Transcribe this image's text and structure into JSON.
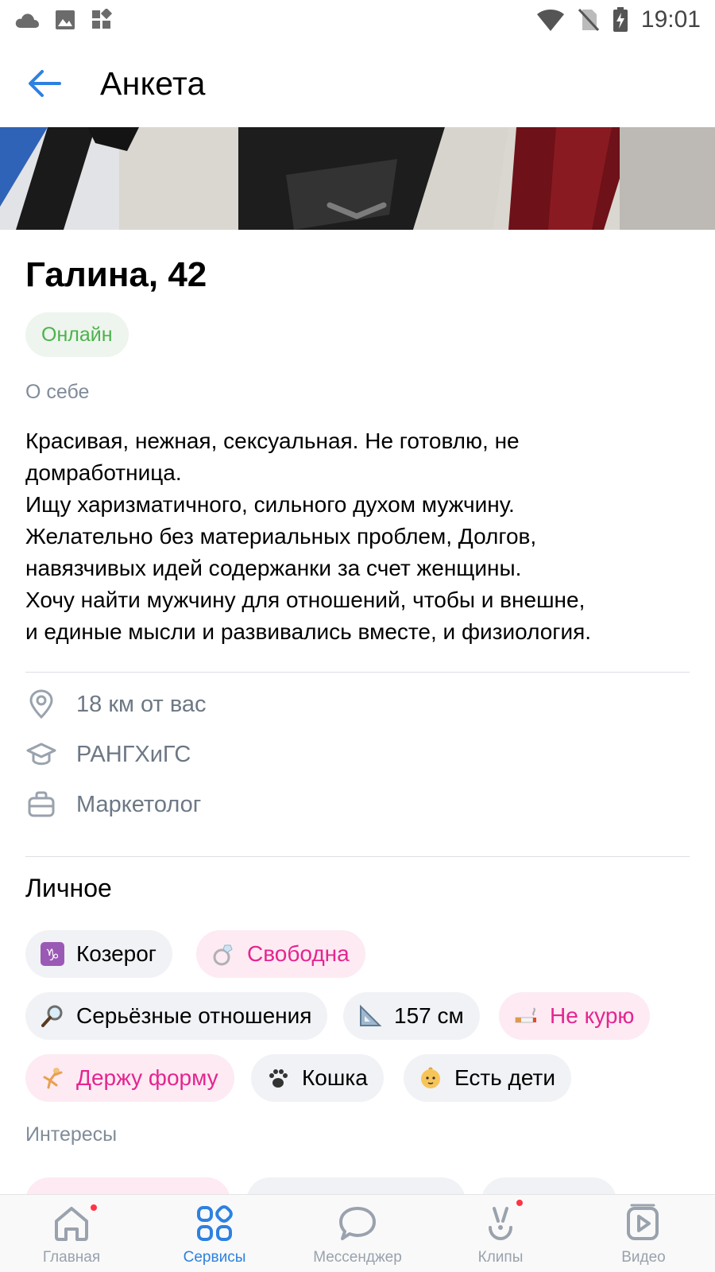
{
  "status_bar": {
    "time": "19:01"
  },
  "header": {
    "title": "Анкета"
  },
  "profile": {
    "name": "Галина, 42",
    "status": "Онлайн",
    "about_label": "О себе",
    "about_text": "Красивая, нежная, сексуальная. Не готовлю, не\nдомработница.\nИщу харизматичного, сильного духом мужчину.\nЖелательно без материальных проблем, Долгов,\nнавязчивых идей содержанки за счет женщины.\nХочу найти мужчину для отношений, чтобы и внешне,\nи единые мысли и развивались вместе, и физиология.",
    "distance": "18 км от вас",
    "education": "РАНГХиГС",
    "job": "Маркетолог"
  },
  "personal": {
    "title": "Личное",
    "chips": {
      "zodiac": {
        "icon": "capricorn-icon",
        "label": "Козерог"
      },
      "relationship": {
        "icon": "ring-icon",
        "label": "Свободна"
      },
      "goal": {
        "icon": "magnifier-icon",
        "label": "Серьёзные отношения"
      },
      "height": {
        "icon": "ruler-icon",
        "label": "157 см"
      },
      "smoking": {
        "icon": "cigarette-icon",
        "label": "Не курю"
      },
      "sport": {
        "icon": "gymnast-icon",
        "label": "Держу форму"
      },
      "pets": {
        "icon": "paw-icon",
        "label": "Кошка"
      },
      "kids": {
        "icon": "baby-icon",
        "label": "Есть дети"
      }
    }
  },
  "interests": {
    "label": "Интересы"
  },
  "bottom_nav": {
    "home": "Главная",
    "services": "Сервисы",
    "messenger": "Мессенджер",
    "clips": "Клипы",
    "video": "Видео"
  },
  "colors": {
    "accent": "#2d81e0",
    "online_green": "#4bb34b",
    "pink": "#e5258f",
    "chip_bg": "#f0f2f5",
    "pink_chip_bg": "#fdeaf3",
    "secondary_text": "#818c99",
    "badge_red": "#ff3347"
  }
}
